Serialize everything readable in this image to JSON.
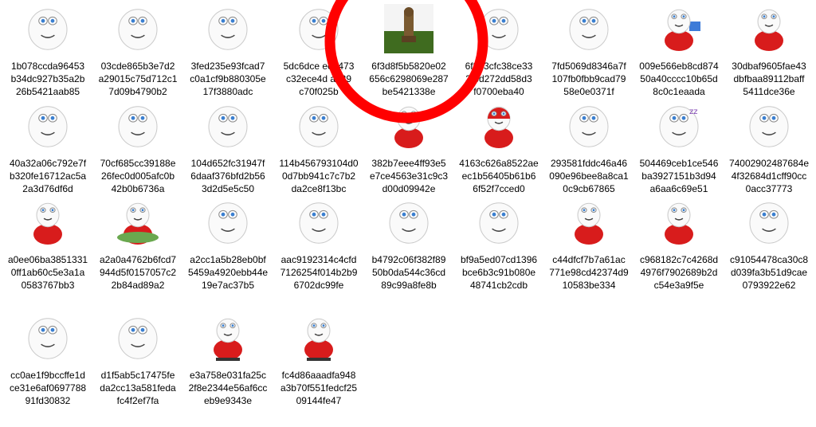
{
  "view": "large-icons",
  "annotation": {
    "shape": "circle",
    "color": "#ff0000"
  },
  "files": [
    {
      "name": [
        "1b078ccda96453",
        "b34dc927b35a2b",
        "26b5421aab85"
      ],
      "icon": "cartoon-face-thumbnail"
    },
    {
      "name": [
        "03cde865b3e7d2",
        "a29015c75d712c1",
        "7d09b4790b2"
      ],
      "icon": "cartoon-face-thumbnail"
    },
    {
      "name": [
        "3fed235e93fcad7",
        "c0a1cf9b880305e",
        "17f3880adc"
      ],
      "icon": "cartoon-face-thumbnail"
    },
    {
      "name": [
        "5dc6dce  eee473",
        "c32ece4d  ab89",
        "c70f025b"
      ],
      "icon": "cartoon-face-thumbnail"
    },
    {
      "name": [
        "6f3d8f5b5820e02",
        "656c6298069e287",
        "be5421338e"
      ],
      "icon": "statue-thumbnail"
    },
    {
      "name": [
        "6f3  f3cfc38ce33",
        "3  3d272dd58d3",
        "f0700eba40"
      ],
      "icon": "cartoon-face-thumbnail"
    },
    {
      "name": [
        "7fd5069d8346a7f",
        "107fb0fbb9cad79",
        "58e0e0371f"
      ],
      "icon": "cartoon-face-thumbnail"
    },
    {
      "name": [
        "009e566eb8cd874",
        "50a40cccc10b65d",
        "8c0c1eaada"
      ],
      "icon": "cartoon-laptop-thumbnail"
    },
    {
      "name": [
        "30dbaf9605fae43",
        "dbfbaa89112baff",
        "5411dce36e"
      ],
      "icon": "cartoon-lying-thumbnail"
    },
    {
      "name": [
        "40a32a06c792e7f",
        "b320fe16712ac5a",
        "2a3d76df6d"
      ],
      "icon": "cartoon-face-thumbnail"
    },
    {
      "name": [
        "70cf685cc39188e",
        "26fec0d005afc0b",
        "42b0b6736a"
      ],
      "icon": "cartoon-face-thumbnail"
    },
    {
      "name": [
        "104d652fc31947f",
        "6daaf376bfd2b56",
        "3d2d5e5c50"
      ],
      "icon": "cartoon-face-thumbnail"
    },
    {
      "name": [
        "114b456793104d0",
        "0d7bb941c7c7b2",
        "da2ce8f13bc"
      ],
      "icon": "cartoon-face-thumbnail"
    },
    {
      "name": [
        "382b7eee4ff93e5",
        "e7ce4563e31c9c3",
        "d00d09942e"
      ],
      "icon": "cartoon-red-thumbnail"
    },
    {
      "name": [
        "4163c626a8522ae",
        "ec1b56405b61b6",
        "6f52f7cced0"
      ],
      "icon": "cartoon-helmet-thumbnail"
    },
    {
      "name": [
        "293581fddc46a46",
        "090e96bee8a8ca1",
        "0c9cb67865"
      ],
      "icon": "cartoon-face-thumbnail"
    },
    {
      "name": [
        "504469ceb1ce546",
        "ba3927151b3d94",
        "a6aa6c69e51"
      ],
      "icon": "cartoon-sleep-thumbnail"
    },
    {
      "name": [
        "74002902487684e",
        "4f32684d1cff90cc",
        "0acc37773"
      ],
      "icon": "cartoon-face-thumbnail"
    },
    {
      "name": [
        "a0ee06ba3851331",
        "0ff1ab60c5e3a1a",
        "0583767bb3"
      ],
      "icon": "cartoon-red-thumbnail"
    },
    {
      "name": [
        "a2a0a4762b6fcd7",
        "944d5f0157057c2",
        "2b84ad89a2"
      ],
      "icon": "cartoon-surf-thumbnail"
    },
    {
      "name": [
        "a2cc1a5b28eb0bf",
        "5459a4920ebb44e",
        "19e7ac37b5"
      ],
      "icon": "cartoon-face-thumbnail"
    },
    {
      "name": [
        "aac9192314c4cfd",
        "7126254f014b2b9",
        "6702dc99fe"
      ],
      "icon": "cartoon-face-thumbnail"
    },
    {
      "name": [
        "b4792c06f382f89",
        "50b0da544c36cd",
        "89c99a8fe8b"
      ],
      "icon": "cartoon-face-thumbnail"
    },
    {
      "name": [
        "bf9a5ed07cd1396",
        "bce6b3c91b080e",
        "48741cb2cdb"
      ],
      "icon": "cartoon-face-thumbnail"
    },
    {
      "name": [
        "c44dfcf7b7a61ac",
        "771e98cd42374d9",
        "10583be334"
      ],
      "icon": "cartoon-red-thumbnail"
    },
    {
      "name": [
        "c968182c7c4268d",
        "4976f7902689b2d",
        "c54e3a9f5e"
      ],
      "icon": "cartoon-lying-thumbnail"
    },
    {
      "name": [
        "c91054478ca30c8",
        "d039fa3b51d9cae",
        "0793922e62"
      ],
      "icon": "cartoon-face-thumbnail"
    },
    {
      "name": [
        "cc0ae1f9bccffe1d",
        "ce31e6af0697788",
        "91fd30832"
      ],
      "icon": "cartoon-face-thumbnail"
    },
    {
      "name": [
        "d1f5ab5c17475fe",
        "da2cc13a581feda",
        "fc4f2ef7fa"
      ],
      "icon": "cartoon-face-thumbnail"
    },
    {
      "name": [
        "e3a758e031fa25c",
        "2f8e2344e56af6cc",
        "eb9e9343e"
      ],
      "icon": "cartoon-skate-thumbnail"
    },
    {
      "name": [
        "fc4d86aaadfa948",
        "a3b70f551fedcf25",
        "09144fe47"
      ],
      "icon": "cartoon-skate-thumbnail"
    }
  ]
}
